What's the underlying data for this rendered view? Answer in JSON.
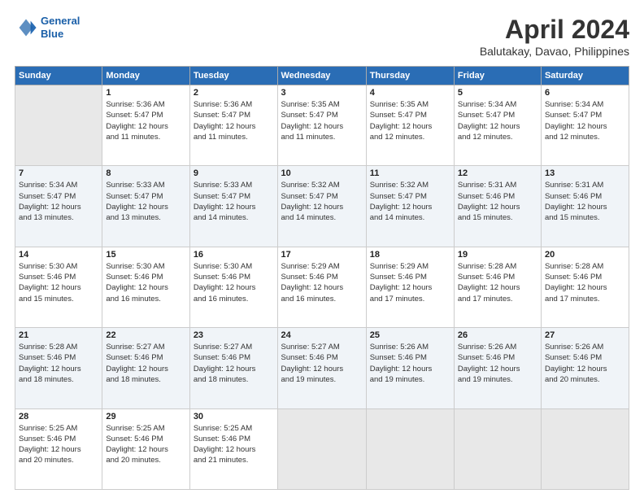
{
  "header": {
    "logo_line1": "General",
    "logo_line2": "Blue",
    "title": "April 2024",
    "subtitle": "Balutakay, Davao, Philippines"
  },
  "days_of_week": [
    "Sunday",
    "Monday",
    "Tuesday",
    "Wednesday",
    "Thursday",
    "Friday",
    "Saturday"
  ],
  "weeks": [
    [
      {
        "day": "",
        "info": ""
      },
      {
        "day": "1",
        "info": "Sunrise: 5:36 AM\nSunset: 5:47 PM\nDaylight: 12 hours\nand 11 minutes."
      },
      {
        "day": "2",
        "info": "Sunrise: 5:36 AM\nSunset: 5:47 PM\nDaylight: 12 hours\nand 11 minutes."
      },
      {
        "day": "3",
        "info": "Sunrise: 5:35 AM\nSunset: 5:47 PM\nDaylight: 12 hours\nand 11 minutes."
      },
      {
        "day": "4",
        "info": "Sunrise: 5:35 AM\nSunset: 5:47 PM\nDaylight: 12 hours\nand 12 minutes."
      },
      {
        "day": "5",
        "info": "Sunrise: 5:34 AM\nSunset: 5:47 PM\nDaylight: 12 hours\nand 12 minutes."
      },
      {
        "day": "6",
        "info": "Sunrise: 5:34 AM\nSunset: 5:47 PM\nDaylight: 12 hours\nand 12 minutes."
      }
    ],
    [
      {
        "day": "7",
        "info": "Sunrise: 5:34 AM\nSunset: 5:47 PM\nDaylight: 12 hours\nand 13 minutes."
      },
      {
        "day": "8",
        "info": "Sunrise: 5:33 AM\nSunset: 5:47 PM\nDaylight: 12 hours\nand 13 minutes."
      },
      {
        "day": "9",
        "info": "Sunrise: 5:33 AM\nSunset: 5:47 PM\nDaylight: 12 hours\nand 14 minutes."
      },
      {
        "day": "10",
        "info": "Sunrise: 5:32 AM\nSunset: 5:47 PM\nDaylight: 12 hours\nand 14 minutes."
      },
      {
        "day": "11",
        "info": "Sunrise: 5:32 AM\nSunset: 5:47 PM\nDaylight: 12 hours\nand 14 minutes."
      },
      {
        "day": "12",
        "info": "Sunrise: 5:31 AM\nSunset: 5:46 PM\nDaylight: 12 hours\nand 15 minutes."
      },
      {
        "day": "13",
        "info": "Sunrise: 5:31 AM\nSunset: 5:46 PM\nDaylight: 12 hours\nand 15 minutes."
      }
    ],
    [
      {
        "day": "14",
        "info": "Sunrise: 5:30 AM\nSunset: 5:46 PM\nDaylight: 12 hours\nand 15 minutes."
      },
      {
        "day": "15",
        "info": "Sunrise: 5:30 AM\nSunset: 5:46 PM\nDaylight: 12 hours\nand 16 minutes."
      },
      {
        "day": "16",
        "info": "Sunrise: 5:30 AM\nSunset: 5:46 PM\nDaylight: 12 hours\nand 16 minutes."
      },
      {
        "day": "17",
        "info": "Sunrise: 5:29 AM\nSunset: 5:46 PM\nDaylight: 12 hours\nand 16 minutes."
      },
      {
        "day": "18",
        "info": "Sunrise: 5:29 AM\nSunset: 5:46 PM\nDaylight: 12 hours\nand 17 minutes."
      },
      {
        "day": "19",
        "info": "Sunrise: 5:28 AM\nSunset: 5:46 PM\nDaylight: 12 hours\nand 17 minutes."
      },
      {
        "day": "20",
        "info": "Sunrise: 5:28 AM\nSunset: 5:46 PM\nDaylight: 12 hours\nand 17 minutes."
      }
    ],
    [
      {
        "day": "21",
        "info": "Sunrise: 5:28 AM\nSunset: 5:46 PM\nDaylight: 12 hours\nand 18 minutes."
      },
      {
        "day": "22",
        "info": "Sunrise: 5:27 AM\nSunset: 5:46 PM\nDaylight: 12 hours\nand 18 minutes."
      },
      {
        "day": "23",
        "info": "Sunrise: 5:27 AM\nSunset: 5:46 PM\nDaylight: 12 hours\nand 18 minutes."
      },
      {
        "day": "24",
        "info": "Sunrise: 5:27 AM\nSunset: 5:46 PM\nDaylight: 12 hours\nand 19 minutes."
      },
      {
        "day": "25",
        "info": "Sunrise: 5:26 AM\nSunset: 5:46 PM\nDaylight: 12 hours\nand 19 minutes."
      },
      {
        "day": "26",
        "info": "Sunrise: 5:26 AM\nSunset: 5:46 PM\nDaylight: 12 hours\nand 19 minutes."
      },
      {
        "day": "27",
        "info": "Sunrise: 5:26 AM\nSunset: 5:46 PM\nDaylight: 12 hours\nand 20 minutes."
      }
    ],
    [
      {
        "day": "28",
        "info": "Sunrise: 5:25 AM\nSunset: 5:46 PM\nDaylight: 12 hours\nand 20 minutes."
      },
      {
        "day": "29",
        "info": "Sunrise: 5:25 AM\nSunset: 5:46 PM\nDaylight: 12 hours\nand 20 minutes."
      },
      {
        "day": "30",
        "info": "Sunrise: 5:25 AM\nSunset: 5:46 PM\nDaylight: 12 hours\nand 21 minutes."
      },
      {
        "day": "",
        "info": ""
      },
      {
        "day": "",
        "info": ""
      },
      {
        "day": "",
        "info": ""
      },
      {
        "day": "",
        "info": ""
      }
    ]
  ]
}
